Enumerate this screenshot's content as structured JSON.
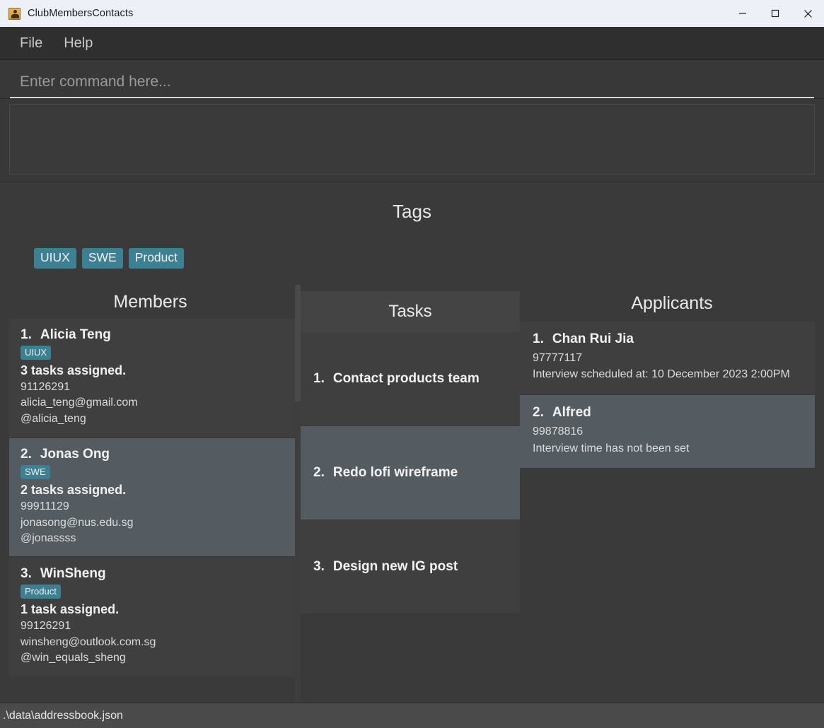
{
  "window": {
    "title": "ClubMembersContacts",
    "icon": "address-book-icon",
    "controls": {
      "minimize": "minimize-icon",
      "maximize": "maximize-icon",
      "close": "close-icon"
    }
  },
  "menu": {
    "items": [
      {
        "label": "File"
      },
      {
        "label": "Help"
      }
    ]
  },
  "command": {
    "value": "",
    "placeholder": "Enter command here..."
  },
  "result": {
    "text": ""
  },
  "tags": {
    "title": "Tags",
    "chips": [
      {
        "label": "UIUX",
        "color": "#3d7f93"
      },
      {
        "label": "SWE",
        "color": "#3d7f93"
      },
      {
        "label": "Product",
        "color": "#3d7f93"
      }
    ]
  },
  "members": {
    "title": "Members",
    "cards": [
      {
        "index": "1.",
        "name": "Alicia Teng",
        "tags": [
          "UIUX"
        ],
        "tasks_summary": "3 tasks assigned.",
        "phone": "91126291",
        "email": "alicia_teng@gmail.com",
        "handle": "@alicia_teng",
        "selected": false
      },
      {
        "index": "2.",
        "name": "Jonas Ong",
        "tags": [
          "SWE"
        ],
        "tasks_summary": "2 tasks assigned.",
        "phone": "99911129",
        "email": "jonasong@nus.edu.sg",
        "handle": "@jonassss",
        "selected": true
      },
      {
        "index": "3.",
        "name": "WinSheng",
        "tags": [
          "Product"
        ],
        "tasks_summary": "1 task assigned.",
        "phone": "99126291",
        "email": "winsheng@outlook.com.sg",
        "handle": "@win_equals_sheng",
        "selected": false
      }
    ]
  },
  "tasks": {
    "title": "Tasks",
    "cards": [
      {
        "index": "1.",
        "name": "Contact products team",
        "selected": false
      },
      {
        "index": "2.",
        "name": "Redo lofi wireframe",
        "selected": true
      },
      {
        "index": "3.",
        "name": "Design new IG post",
        "selected": false
      }
    ]
  },
  "applicants": {
    "title": "Applicants",
    "cards": [
      {
        "index": "1.",
        "name": "Chan Rui Jia",
        "phone": "97777117",
        "interview": "Interview scheduled at: 10 December 2023 2:00PM",
        "selected": false
      },
      {
        "index": "2.",
        "name": "Alfred",
        "phone": "99878816",
        "interview": "Interview time has not been set",
        "selected": true
      }
    ]
  },
  "status": {
    "path": ".\\data\\addressbook.json"
  }
}
